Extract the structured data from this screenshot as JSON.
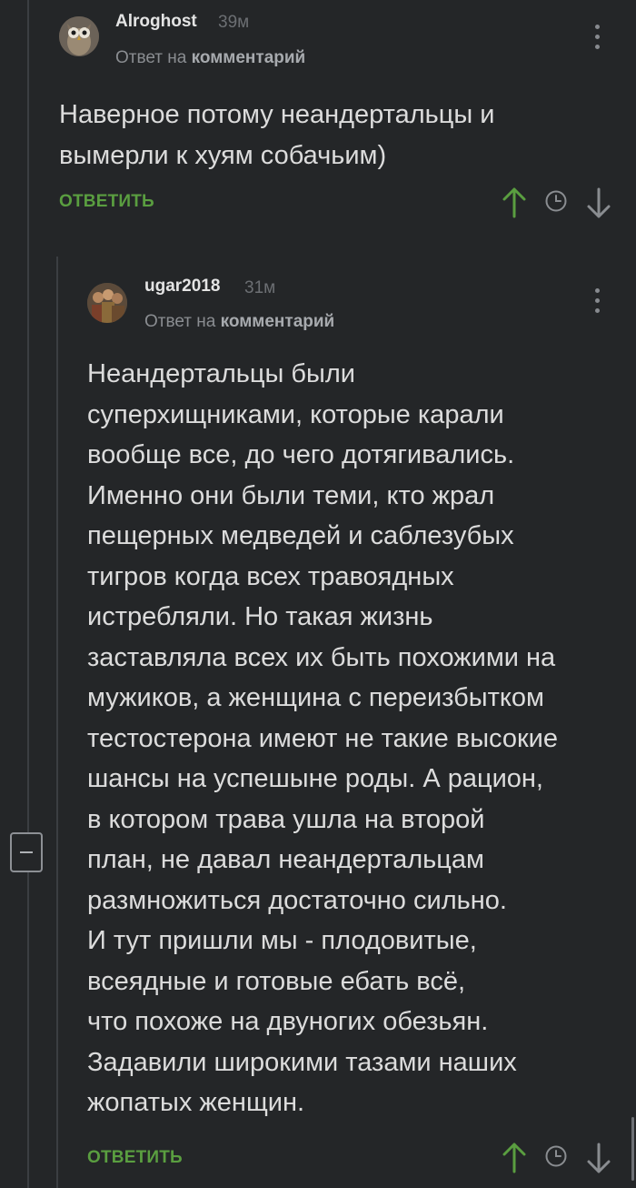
{
  "colors": {
    "background": "#242628",
    "accent_green": "#5a9e40",
    "text": "#dcdcdc",
    "muted": "#8a8d91",
    "thread_line": "#3b3e42"
  },
  "comments": [
    {
      "author": "Alroghost",
      "time": "39м",
      "reply_prefix": "Ответ на",
      "reply_target": "комментарий",
      "avatar_icon": "owl-avatar",
      "lines": [
        "Наверное потому неандертальцы и",
        "вымерли к хуям собачьим)"
      ],
      "reply_label": "ОТВЕТИТЬ",
      "vote_up_voted": true
    },
    {
      "author": "ugar2018",
      "time": "31м",
      "reply_prefix": "Ответ на",
      "reply_target": "комментарий",
      "avatar_icon": "group-avatar",
      "lines": [
        "Неандертальцы были",
        "суперхищниками, которые карали",
        "вообще все, до чего дотягивались.",
        "Именно они были теми, кто жрал",
        "пещерных медведей и саблезубых",
        "тигров когда всех травоядных",
        "истребляли. Но такая жизнь",
        "заставляла всех их быть похожими на",
        "мужиков, а женщина с переизбытком",
        "тестостерона имеют не такие высокие",
        "шансы на успешыне роды. А рацион,",
        "в котором трава ушла на второй",
        "план, не давал неандертальцам",
        "размножиться достаточно сильно.",
        "И тут пришли мы - плодовитые,",
        "всеядные и готовые ебать всё,",
        "что похоже на двуногих обезьян.",
        "Задавили широкими тазами наших",
        "жопатых женщин."
      ],
      "reply_label": "ОТВЕТИТЬ",
      "vote_up_voted": true
    }
  ]
}
